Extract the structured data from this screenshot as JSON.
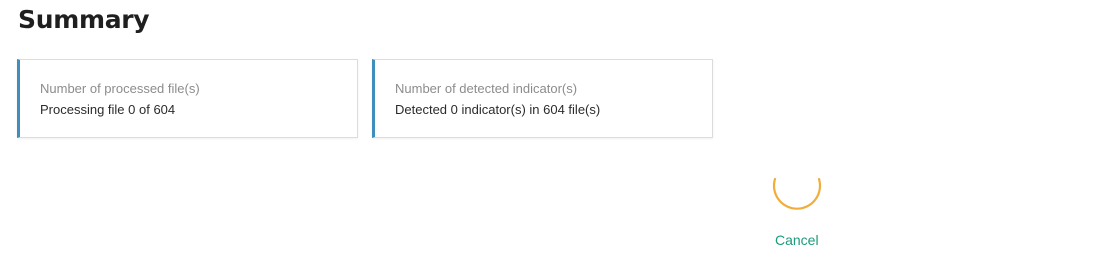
{
  "header": {
    "title": "Summary"
  },
  "cards": [
    {
      "label": "Number of processed file(s)",
      "value": "Processing file 0 of 604"
    },
    {
      "label": "Number of detected indicator(s)",
      "value": "Detected 0 indicator(s) in 604 file(s)"
    }
  ],
  "spinner": {
    "icon": "loading-spinner-icon",
    "color": "#f0ad3a"
  },
  "actions": {
    "cancel_label": "Cancel"
  },
  "colors": {
    "accent_border": "#3f8fbd",
    "link": "#1b9c7d"
  }
}
